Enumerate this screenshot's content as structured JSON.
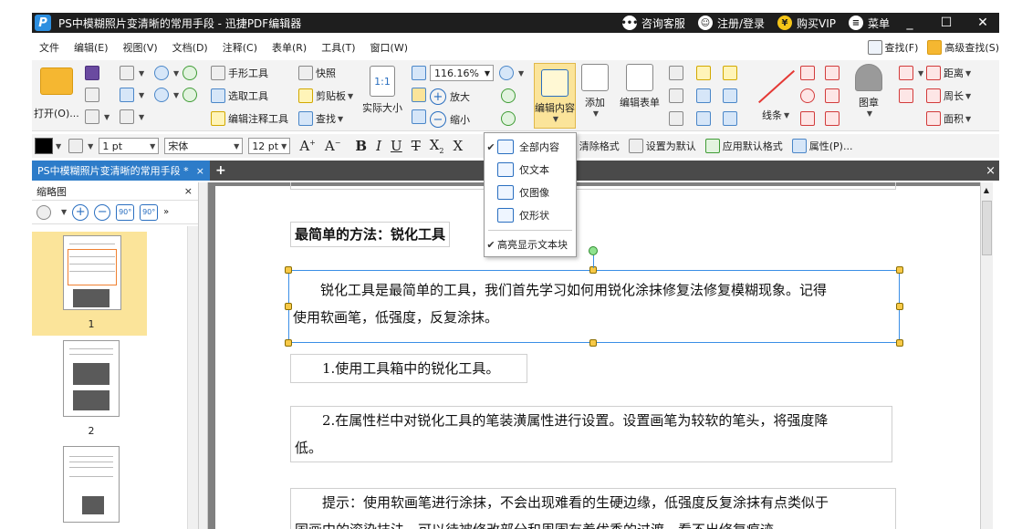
{
  "window": {
    "title": "PS中模糊照片变清晰的常用手段 - 迅捷PDF编辑器",
    "support": "咨询客服",
    "login": "注册/登录",
    "vip": "购买VIP",
    "menu": "菜单",
    "minimize": "_",
    "maximize": "☐",
    "close": "✕"
  },
  "menubar": {
    "items": [
      "文件",
      "编辑(E)",
      "视图(V)",
      "文档(D)",
      "注释(C)",
      "表单(R)",
      "工具(T)",
      "窗口(W)"
    ],
    "find": "查找(F)",
    "advanced_find": "高级查找(S)"
  },
  "ribbon": {
    "open": "打开(O)...",
    "hand_tool": "手形工具",
    "select_tool": "选取工具",
    "edit_annot_tool": "编辑注释工具",
    "snapshot": "快照",
    "clipboard": "剪贴板",
    "find": "查找",
    "actual_size": "实际大小",
    "zoom_value": "116.16%",
    "zoom_in": "放大",
    "zoom_out": "缩小",
    "edit_content": "编辑内容",
    "add": "添加",
    "edit_form": "编辑表单",
    "line": "线条",
    "stamp": "图章",
    "distance": "距离",
    "perimeter": "周长",
    "area": "面积",
    "actual_icon_text": "1:1"
  },
  "format": {
    "line_width": "1 pt",
    "font": "宋体",
    "font_size": "12 pt",
    "clear_format": "清除格式",
    "set_default": "设置为默认",
    "apply_default": "应用默认格式",
    "properties": "属性(P)..."
  },
  "tabs": {
    "doc_tab": "PS中模糊照片变清晰的常用手段 *",
    "close": "×",
    "new": "+",
    "close_all": "×"
  },
  "thumbnails": {
    "title": "缩略图",
    "close": "×",
    "pages": [
      "1",
      "2"
    ]
  },
  "dropdown": {
    "items": [
      {
        "label": "全部内容",
        "checked": true
      },
      {
        "label": "仅文本",
        "checked": false
      },
      {
        "label": "仅图像",
        "checked": false
      },
      {
        "label": "仅形状",
        "checked": false
      }
    ],
    "highlight": "高亮显示文本块"
  },
  "document": {
    "heading": "最简单的方法：锐化工具",
    "para1_line1": "锐化工具是最简单的工具，我们首先学习如何用锐化涂抹修复法修复模糊现象。记得",
    "para1_line2": "使用软画笔，低强度，反复涂抹。",
    "step1": "1.使用工具箱中的锐化工具。",
    "step2_line1": "2.在属性栏中对锐化工具的笔装潢属性进行设置。设置画笔为较软的笔头，将强度降",
    "step2_line2": "低。",
    "tip_line1": "提示：使用软画笔进行涂抹，不会出现难看的生硬边缘，低强度反复涂抹有点类似于",
    "tip_line2": "国画中的滚染技法，可以待被修改部分和周围有着优秀的过渡，看不出修复痕迹。"
  }
}
